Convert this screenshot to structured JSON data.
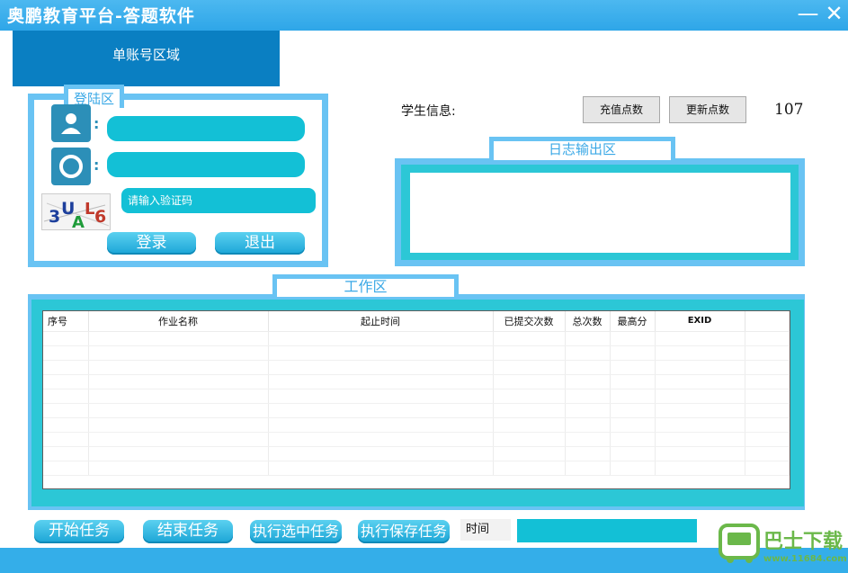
{
  "window": {
    "title": "奥鹏教育平台-答题软件",
    "minimize": "—",
    "close": "✕"
  },
  "account": {
    "tab_label": "单账号区域"
  },
  "login": {
    "title": "登陆区",
    "username_value": "",
    "password_value": "",
    "captcha_placeholder": "请输入验证码",
    "captcha_text": "3UAL6",
    "login_button": "登录",
    "logout_button": "退出"
  },
  "student": {
    "info_label": "学生信息:",
    "recharge_button": "充值点数",
    "refresh_button": "更新点数",
    "points": "107"
  },
  "log": {
    "title": "日志输出区"
  },
  "work": {
    "title": "工作区",
    "columns": [
      "序号",
      "作业名称",
      "起止时间",
      "已提交次数",
      "总次数",
      "最高分",
      "EXID",
      ""
    ],
    "rows": 10
  },
  "actions": {
    "start": "开始任务",
    "end": "结束任务",
    "run_selected": "执行选中任务",
    "run_saved": "执行保存任务",
    "time_label": "时间"
  },
  "watermark": {
    "text": "巴士下载",
    "url": "www.11684.com"
  },
  "colors": {
    "titlebar": "#2ea6e8",
    "panel_frame": "#69c3f3",
    "cyan_accent": "#13c0d6",
    "tab_blue": "#0a7fc2"
  }
}
